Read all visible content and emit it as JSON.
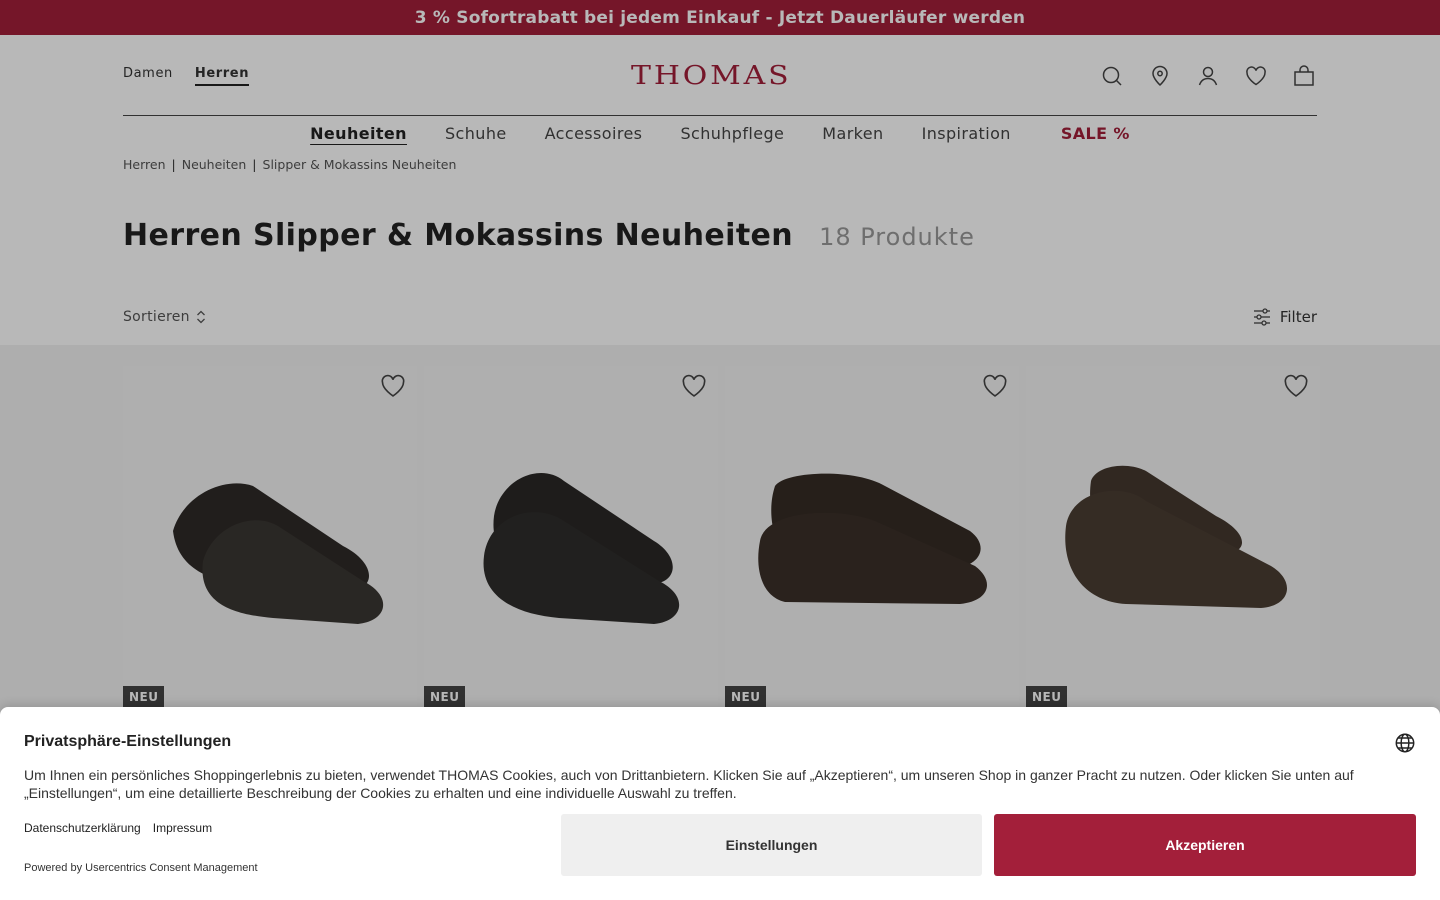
{
  "promo": {
    "text": "3 % Sofortrabatt bei jedem Einkauf - Jetzt Dauerläufer werden"
  },
  "header": {
    "gender_nav": [
      "Damen",
      "Herren"
    ],
    "active_gender": "Herren",
    "logo": "THOMAS",
    "icons": [
      "search-icon",
      "store-locator-icon",
      "account-icon",
      "wishlist-icon",
      "cart-icon"
    ]
  },
  "main_nav": {
    "items": [
      "Neuheiten",
      "Schuhe",
      "Accessoires",
      "Schuhpflege",
      "Marken",
      "Inspiration",
      "SALE %"
    ],
    "active": "Neuheiten"
  },
  "breadcrumb": [
    "Herren",
    "Neuheiten",
    "Slipper & Mokassins Neuheiten"
  ],
  "page": {
    "title": "Herren Slipper & Mokassins Neuheiten",
    "count": "18 Produkte"
  },
  "toolbar": {
    "sort_label": "Sortieren",
    "filter_label": "Filter"
  },
  "products": [
    {
      "badge": "NEU",
      "color": "#3a3632"
    },
    {
      "badge": "NEU",
      "color": "#2f2d2b"
    },
    {
      "badge": "NEU",
      "color": "#3b3029"
    },
    {
      "badge": "NEU",
      "color": "#4a3d33"
    }
  ],
  "cookie": {
    "title": "Privatsphäre-Einstellungen",
    "text": "Um Ihnen ein persönliches Shoppingerlebnis zu bieten, verwendet THOMAS Cookies, auch von Drittanbietern. Klicken Sie auf „Akzeptieren“, um unseren Shop in ganzer Pracht zu nutzen. Oder klicken Sie unten auf „Einstellungen“, um eine detaillierte Beschreibung der Cookies zu erhalten und eine individuelle Auswahl zu treffen.",
    "links": [
      "Datenschutzerklärung",
      "Impressum"
    ],
    "powered": "Powered by Usercentrics Consent Management",
    "settings_button": "Einstellungen",
    "accept_button": "Akzeptieren"
  },
  "colors": {
    "brand": "#a31f3a",
    "overlay": "rgba(0,0,0,0.28)"
  }
}
